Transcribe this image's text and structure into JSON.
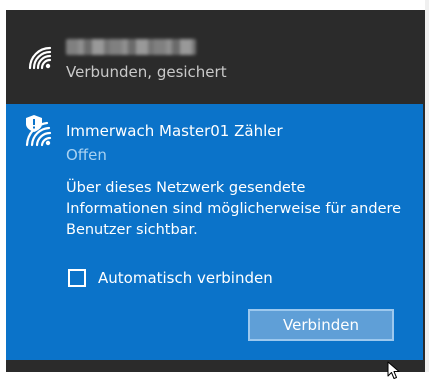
{
  "connected_network": {
    "ssid": "",
    "status": "Verbunden, gesichert",
    "icon": "wifi-icon"
  },
  "selected_network": {
    "ssid": "Immerwach Master01 Zähler",
    "security": "Offen",
    "icon": "wifi-warning-icon",
    "warning_lines": [
      "Über dieses Netzwerk gesendete",
      "Informationen sind möglicherweise für andere",
      "Benutzer sichtbar."
    ],
    "auto_connect_label": "Automatisch verbinden",
    "auto_connect_checked": false,
    "connect_button_label": "Verbinden"
  },
  "colors": {
    "flyout_background": "#2b2b2b",
    "selected_background": "#0b73c9",
    "button_background": "#5f9fd7",
    "secondary_text": "#c9c9c9",
    "open_text": "#a9d2f2"
  },
  "cursor": "pointer-cursor-icon"
}
